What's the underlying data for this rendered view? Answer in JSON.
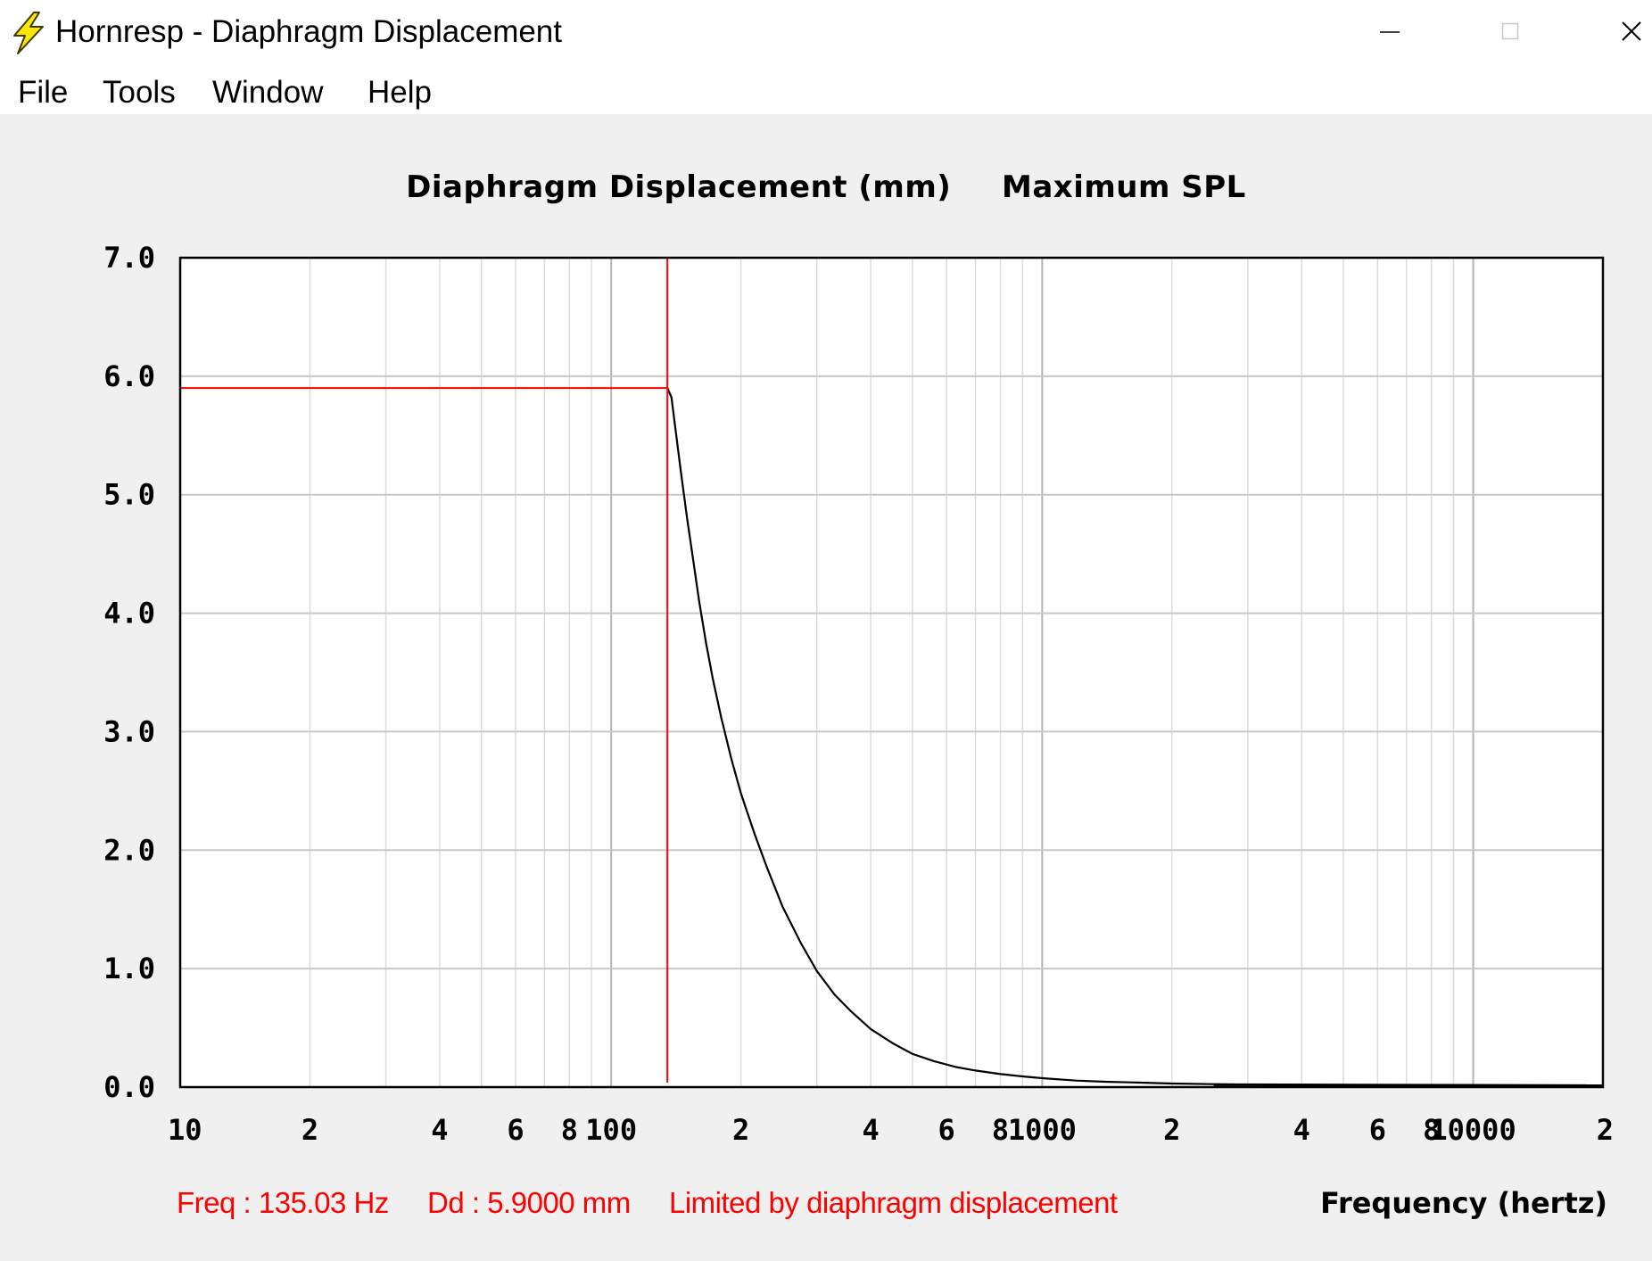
{
  "window": {
    "title": "Hornresp - Diaphragm Displacement",
    "icon": "lightning-bolt-icon",
    "controls": [
      "minimize-icon",
      "maximize-icon",
      "close-icon"
    ]
  },
  "menu": {
    "items": [
      "File",
      "Tools",
      "Window",
      "Help"
    ]
  },
  "colors": {
    "curve": "#000000",
    "cursor": "#ff0000",
    "grid": "#c8c8c8",
    "status_text": "#ff0000",
    "background": "#f0f0f0"
  },
  "chart_data": {
    "type": "line",
    "title_left": "Diaphragm Displacement (mm)",
    "title_right": "Maximum SPL",
    "xlabel": "Frequency (hertz)",
    "ylabel": "",
    "x_scale": "log",
    "xlim": [
      10,
      20000
    ],
    "ylim": [
      0,
      7
    ],
    "grid": true,
    "x_tick_labels": [
      {
        "value": 10,
        "label": "10"
      },
      {
        "value": 20,
        "label": "2"
      },
      {
        "value": 40,
        "label": "4"
      },
      {
        "value": 60,
        "label": "6"
      },
      {
        "value": 80,
        "label": "8"
      },
      {
        "value": 100,
        "label": "100"
      },
      {
        "value": 200,
        "label": "2"
      },
      {
        "value": 400,
        "label": "4"
      },
      {
        "value": 600,
        "label": "6"
      },
      {
        "value": 800,
        "label": "8"
      },
      {
        "value": 1000,
        "label": "1000"
      },
      {
        "value": 2000,
        "label": "2"
      },
      {
        "value": 4000,
        "label": "4"
      },
      {
        "value": 6000,
        "label": "6"
      },
      {
        "value": 8000,
        "label": "8"
      },
      {
        "value": 10000,
        "label": "10000"
      },
      {
        "value": 20000,
        "label": "2"
      }
    ],
    "y_tick_labels": [
      {
        "value": 0,
        "label": "0.0"
      },
      {
        "value": 1,
        "label": "1.0"
      },
      {
        "value": 2,
        "label": "2.0"
      },
      {
        "value": 3,
        "label": "3.0"
      },
      {
        "value": 4,
        "label": "4.0"
      },
      {
        "value": 5,
        "label": "5.0"
      },
      {
        "value": 6,
        "label": "6.0"
      },
      {
        "value": 7,
        "label": "7.0"
      }
    ],
    "series": [
      {
        "x": [
          135,
          138,
          141,
          145,
          150,
          155,
          160,
          166,
          172,
          180,
          190,
          200,
          215,
          230,
          250,
          275,
          300,
          330,
          360,
          400,
          450,
          500,
          560,
          630,
          700,
          800,
          900,
          1000,
          1200,
          1400,
          1600,
          2000,
          2500,
          3000,
          4000,
          5000,
          7000,
          10000,
          15000,
          20000
        ],
        "y": [
          5.9,
          5.82,
          5.55,
          5.2,
          4.8,
          4.45,
          4.1,
          3.75,
          3.45,
          3.12,
          2.77,
          2.48,
          2.14,
          1.85,
          1.52,
          1.22,
          0.98,
          0.78,
          0.64,
          0.49,
          0.37,
          0.28,
          0.22,
          0.17,
          0.14,
          0.11,
          0.09,
          0.075,
          0.055,
          0.045,
          0.04,
          0.03,
          0.025,
          0.02,
          0.015,
          0.012,
          0.01,
          0.008,
          0.006,
          0.005
        ]
      }
    ],
    "cursor": {
      "x": 135.03,
      "y": 5.9
    }
  },
  "status": {
    "freq": "Freq : 135.03 Hz",
    "dd": "Dd : 5.9000 mm",
    "note": "Limited by diaphragm displacement"
  }
}
